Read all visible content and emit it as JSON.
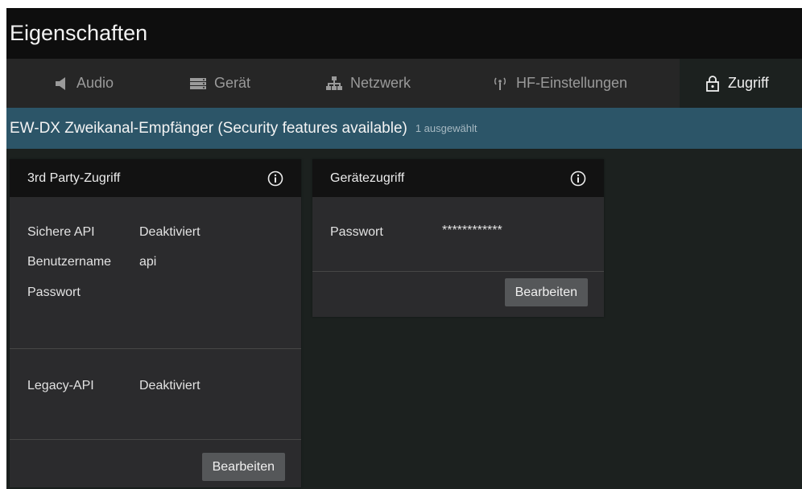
{
  "window": {
    "title": "Eigenschaften"
  },
  "tabs": [
    {
      "label": "Audio",
      "icon": "speaker-icon"
    },
    {
      "label": "Gerät",
      "icon": "device-icon"
    },
    {
      "label": "Netzwerk",
      "icon": "network-icon"
    },
    {
      "label": "HF-Einstellungen",
      "icon": "antenna-icon"
    },
    {
      "label": "Zugriff",
      "icon": "lock-icon",
      "active": true
    }
  ],
  "device": {
    "name": "EW-DX Zweikanal-Empfänger (Security features available)",
    "selection": "1 ausgewählt"
  },
  "third_party": {
    "title": "3rd Party-Zugriff",
    "secure_api_label": "Sichere API",
    "secure_api_value": "Deaktiviert",
    "username_label": "Benutzername",
    "username_value": "api",
    "password_label": "Passwort",
    "password_value": "",
    "legacy_api_label": "Legacy-API",
    "legacy_api_value": "Deaktiviert",
    "edit_label": "Bearbeiten"
  },
  "device_access": {
    "title": "Gerätezugriff",
    "password_label": "Passwort",
    "password_value": "************",
    "edit_label": "Bearbeiten"
  },
  "colors": {
    "titlebar": "#0e0e0e",
    "tabbar": "#262626",
    "devicebar": "#2c5568",
    "card": "#2b2b2d",
    "button": "#555759"
  }
}
